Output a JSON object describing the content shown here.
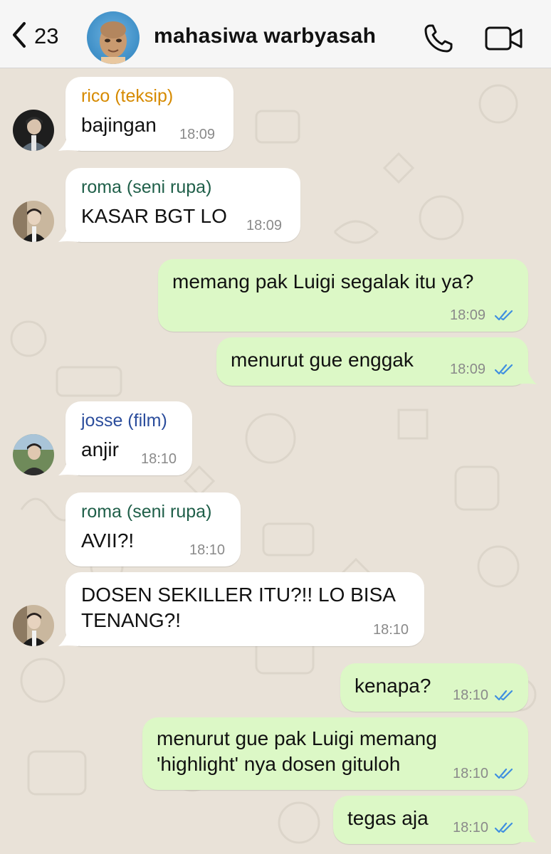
{
  "header": {
    "back_count": "23",
    "title": "mahasiwa warbyasah",
    "icons": [
      "chevron-left-icon",
      "phone-icon",
      "video-camera-icon"
    ]
  },
  "colors": {
    "header_bg": "#f6f6f6",
    "wallpaper": "#e9e2d8",
    "incoming": "#ffffff",
    "outgoing": "#dcf8c6",
    "tick_blue": "#3f8fe0",
    "sender_rico": "#d68a00",
    "sender_roma": "#1f5f49",
    "sender_josse": "#2b4d9c"
  },
  "messages": [
    {
      "direction": "in",
      "sender": "rico (teksip)",
      "text": "bajingan",
      "time": "18:09"
    },
    {
      "direction": "in",
      "sender": "roma (seni rupa)",
      "text": "KASAR BGT LO",
      "time": "18:09"
    },
    {
      "direction": "out",
      "text": "memang pak Luigi segalak itu ya?",
      "time": "18:09",
      "status": "read"
    },
    {
      "direction": "out",
      "text": "menurut gue enggak",
      "time": "18:09",
      "status": "read"
    },
    {
      "direction": "in",
      "sender": "josse (film)",
      "text": "anjir",
      "time": "18:10"
    },
    {
      "direction": "in",
      "sender": "roma (seni rupa)",
      "text": "AVII?!",
      "time": "18:10"
    },
    {
      "direction": "in",
      "text": "DOSEN SEKILLER ITU?!! LO BISA\nTENANG?!",
      "time": "18:10"
    },
    {
      "direction": "out",
      "text": "kenapa?",
      "time": "18:10",
      "status": "read"
    },
    {
      "direction": "out",
      "text": "menurut gue pak Luigi memang\n'highlight' nya dosen gituloh",
      "time": "18:10",
      "status": "read"
    },
    {
      "direction": "out",
      "text": "tegas aja",
      "time": "18:10",
      "status": "read"
    }
  ]
}
